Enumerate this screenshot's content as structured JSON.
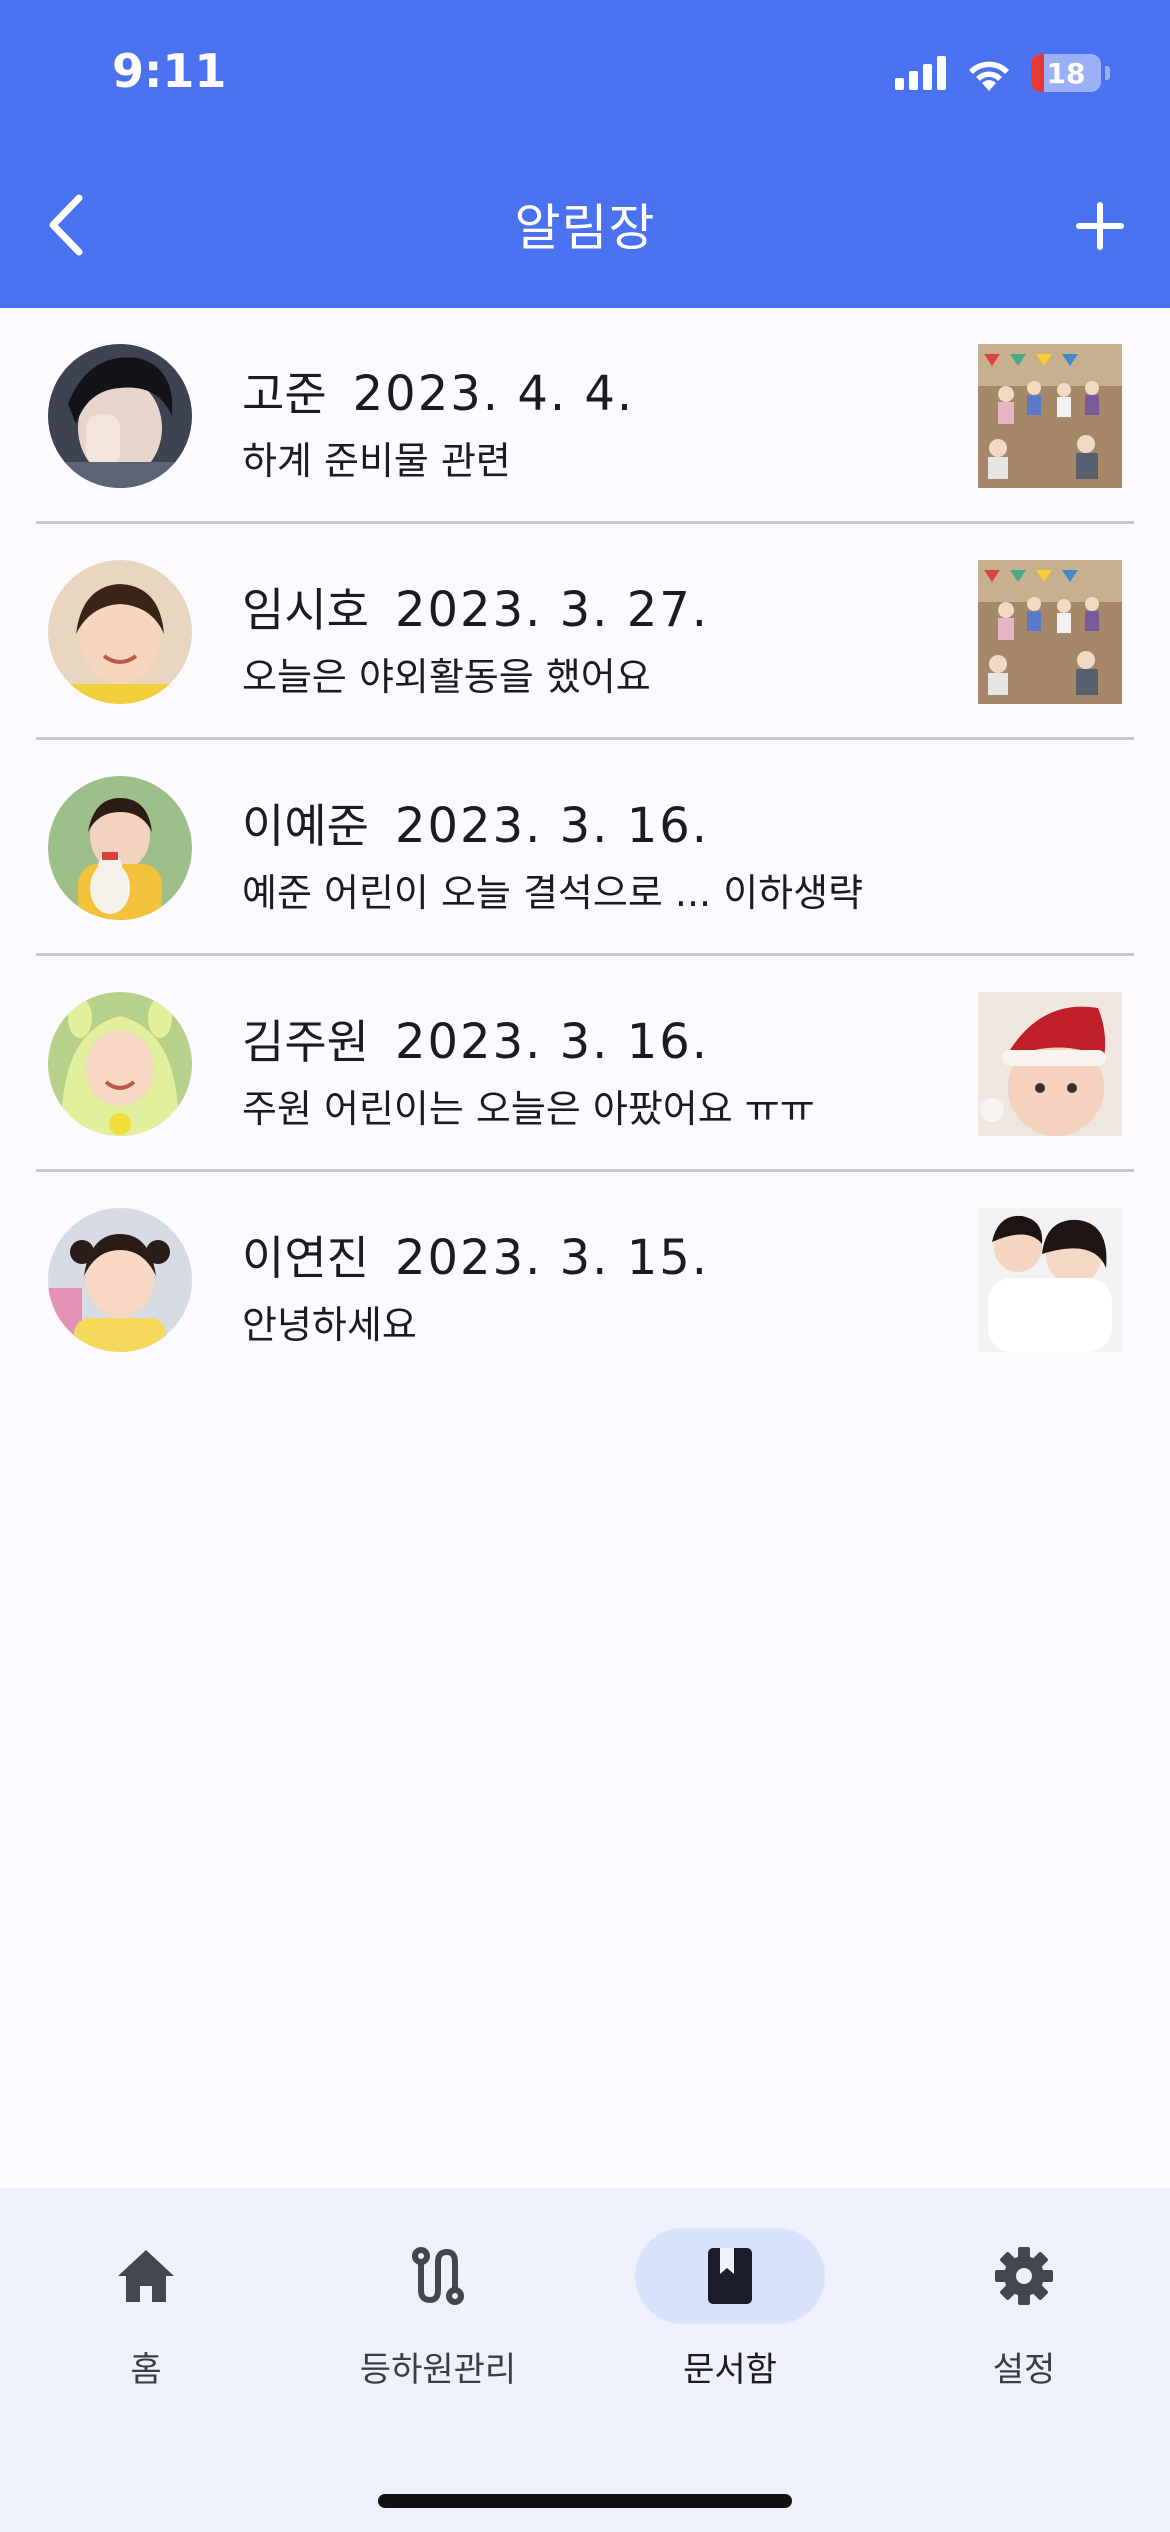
{
  "status_bar": {
    "time": "9:11",
    "battery": "18",
    "battery_level": 0.18
  },
  "header": {
    "title": "알림장",
    "back_icon": "chevron-left-icon",
    "add_icon": "plus-icon"
  },
  "notices": [
    {
      "name": "고준",
      "date": "2023. 4. 4.",
      "preview": "하계 준비물 관련",
      "has_thumbnail": true,
      "thumbnail": "playground-photo"
    },
    {
      "name": "임시호",
      "date": "2023. 3. 27.",
      "preview": "오늘은 야외활동을 했어요",
      "has_thumbnail": true,
      "thumbnail": "playground-photo"
    },
    {
      "name": "이예준",
      "date": "2023. 3. 16.",
      "preview": "예준 어린이 오늘 결석으로 ... 이하생략",
      "has_thumbnail": false
    },
    {
      "name": "김주원",
      "date": "2023. 3. 16.",
      "preview": "주원 어린이는 오늘은 아팠어요 ㅠㅠ",
      "has_thumbnail": true,
      "thumbnail": "baby-santa-hat-photo"
    },
    {
      "name": "이연진",
      "date": "2023. 3. 15.",
      "preview": "안녕하세요",
      "has_thumbnail": true,
      "thumbnail": "mother-child-photo"
    }
  ],
  "bottom_nav": {
    "items": [
      {
        "label": "홈",
        "icon": "home-icon",
        "active": false
      },
      {
        "label": "등하원관리",
        "icon": "route-icon",
        "active": false
      },
      {
        "label": "문서함",
        "icon": "book-icon",
        "active": true
      },
      {
        "label": "설정",
        "icon": "gear-icon",
        "active": false
      }
    ]
  },
  "colors": {
    "primary": "#4a72f0",
    "background": "#fcfaff",
    "nav_background": "#eef0fb",
    "active_pill": "#d9e2fb"
  }
}
